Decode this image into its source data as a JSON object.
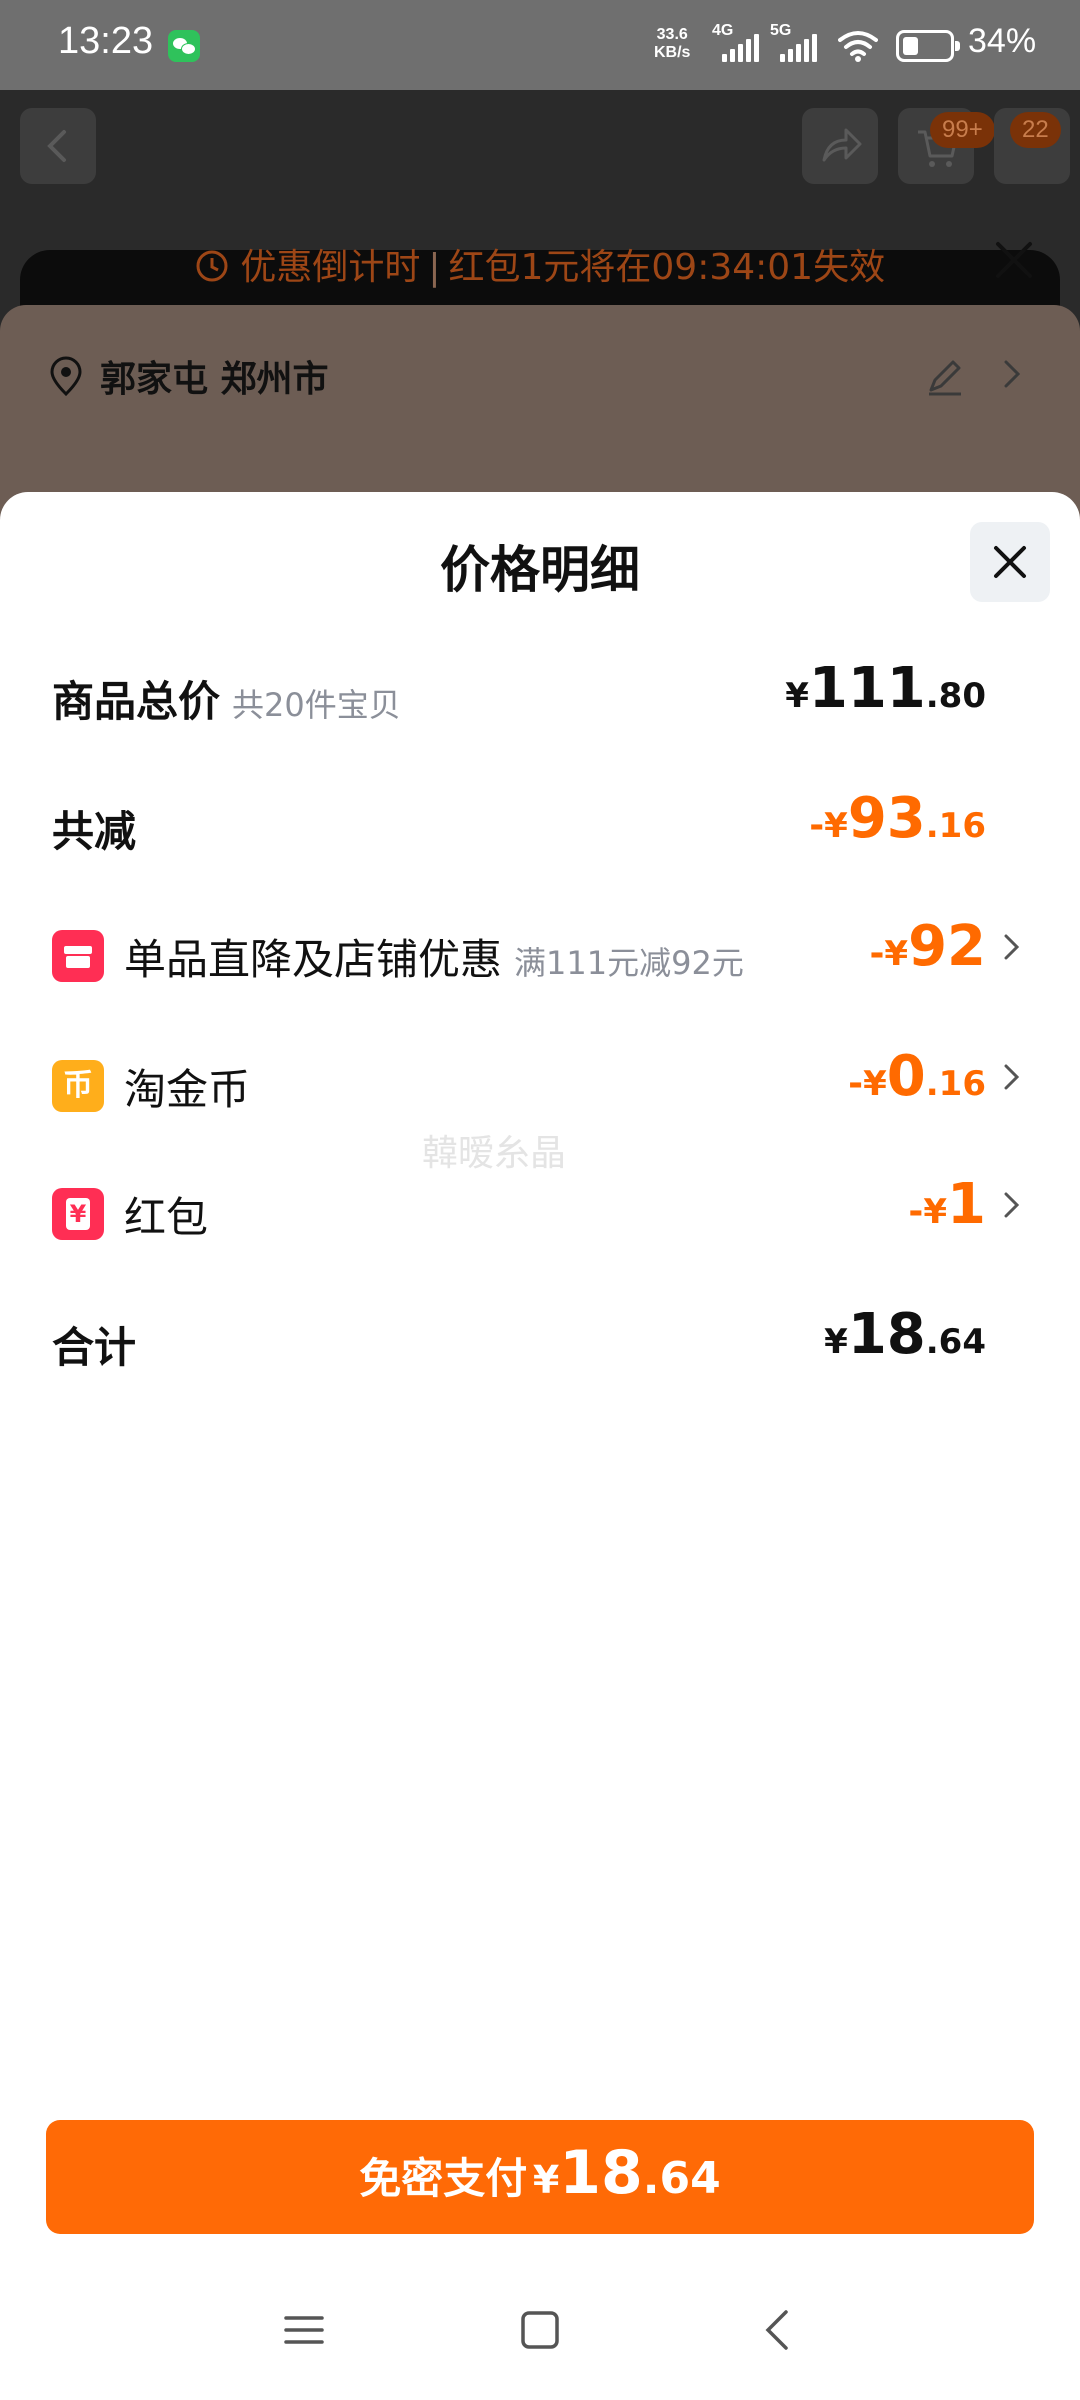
{
  "status_bar": {
    "time": "13:23",
    "net_speed": "33.6",
    "net_unit": "KB/s",
    "signal_1": "4G",
    "signal_2": "5G",
    "battery": "34%"
  },
  "background": {
    "cart_badge": "99+",
    "msg_badge": "22",
    "countdown_label": "优惠倒计时",
    "countdown_text": "红包1元将在09:34:01失效",
    "address": "郭家屯 郑州市"
  },
  "sheet": {
    "title": "价格明细",
    "rows": [
      {
        "label": "商品总价",
        "sub": "共20件宝贝",
        "sign": "",
        "currency": "¥",
        "int": "111",
        "dec": ".80"
      },
      {
        "label": "共减",
        "sub": "",
        "sign": "-",
        "currency": "¥",
        "int": "93",
        "dec": ".16"
      },
      {
        "label": "单品直降及店铺优惠",
        "sub": "满111元减92元",
        "sign": "-",
        "currency": "¥",
        "int": "92",
        "dec": ""
      },
      {
        "label": "淘金币",
        "sub": "",
        "sign": "-",
        "currency": "¥",
        "int": "0",
        "dec": ".16"
      },
      {
        "label": "红包",
        "sub": "",
        "sign": "-",
        "currency": "¥",
        "int": "1",
        "dec": ""
      },
      {
        "label": "合计",
        "sub": "",
        "sign": "",
        "currency": "¥",
        "int": "18",
        "dec": ".64"
      }
    ],
    "watermark": "韓暧糸晶"
  },
  "icons": {
    "shop_icon": "store-icon",
    "coin_icon_glyph": "币",
    "redpacket_glyph": "¥"
  },
  "pay_button": {
    "label": "免密支付",
    "currency": "¥",
    "int": "18",
    "dec": ".64"
  },
  "colors": {
    "accent": "#ff6a00",
    "pay_button": "#ff6a06",
    "text_primary": "#111111",
    "text_secondary": "#8b8f99"
  }
}
